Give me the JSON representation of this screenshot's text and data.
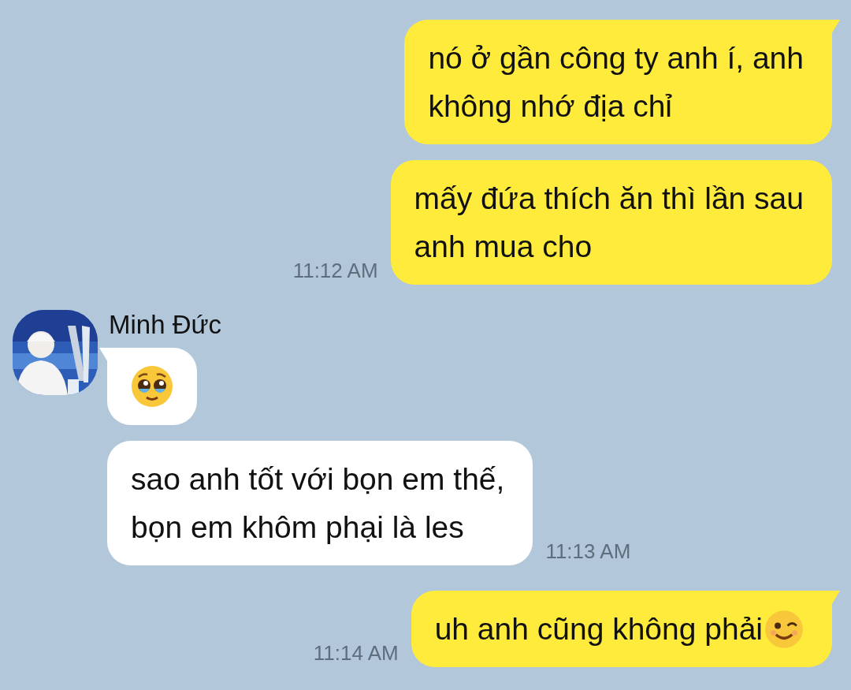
{
  "messages": [
    {
      "from_me": true,
      "kind": "text",
      "tail": true,
      "text": "nó ở gần công ty anh í, anh\nkhông nhớ địa chỉ"
    },
    {
      "from_me": true,
      "kind": "text",
      "tail": false,
      "text": "mấy đứa thích ăn thì lần sau\nanh mua cho",
      "time": "11:12 AM"
    },
    {
      "from_me": false,
      "kind": "emoji",
      "tail": true,
      "sender": "Minh Đức"
    },
    {
      "from_me": false,
      "kind": "text",
      "tail": false,
      "text": "sao anh tốt với bọn em thế,\nbọn em khôm phại là les",
      "time": "11:13 AM"
    },
    {
      "from_me": true,
      "kind": "text",
      "tail": true,
      "text": "uh anh cũng không phải",
      "ends_with_emoji": true,
      "time": "11:14 AM"
    }
  ]
}
